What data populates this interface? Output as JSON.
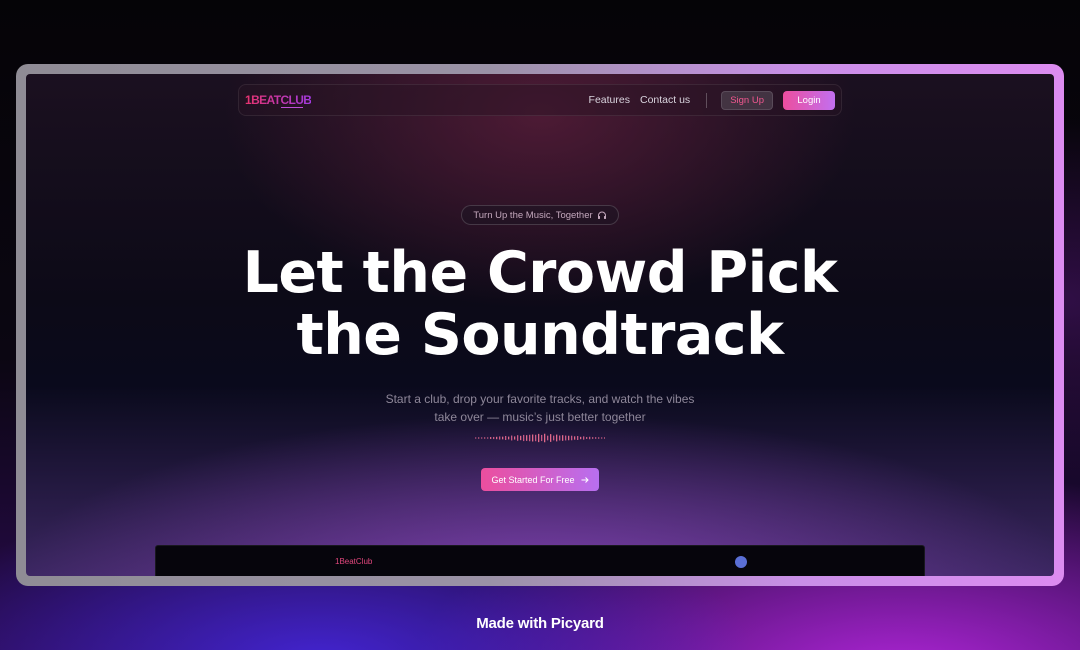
{
  "navbar": {
    "logo": "1BEATCLUB",
    "links": [
      "Features",
      "Contact us"
    ],
    "signup_label": "Sign Up",
    "login_label": "Login"
  },
  "hero": {
    "tagline": "Turn Up the Music, Together",
    "tagline_icon": "headphones-icon",
    "headline_line1": "Let the Crowd Pick",
    "headline_line2": "the Soundtrack",
    "subtitle_line1": "Start a club, drop your favorite tracks, and watch the vibes",
    "subtitle_line2": "take over — music’s just better together",
    "cta_label": "Get Started For Free",
    "cta_icon": "arrow-right-icon"
  },
  "preview": {
    "logo": "1BeatClub"
  },
  "footer": {
    "credit": "Made with Picyard"
  },
  "colors": {
    "accent_pink": "#ec4e9e",
    "accent_purple": "#b86ff0",
    "logo_pink": "#e7336e"
  }
}
